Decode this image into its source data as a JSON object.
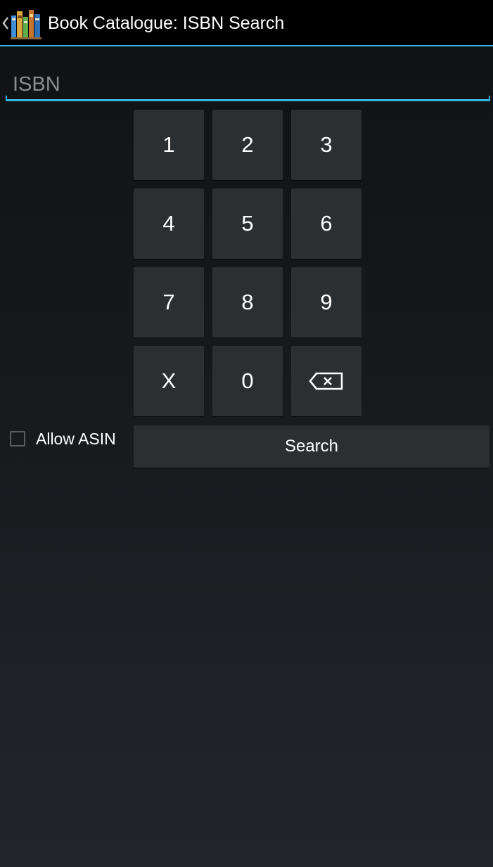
{
  "action_bar": {
    "title": "Book Catalogue: ISBN Search",
    "up_icon": "chevron-left-icon",
    "app_icon": "bookshelf-icon",
    "accent_color": "#33b5e5"
  },
  "isbn_field": {
    "value": "",
    "placeholder": "ISBN"
  },
  "keypad": {
    "keys": [
      {
        "label": "1"
      },
      {
        "label": "2"
      },
      {
        "label": "3"
      },
      {
        "label": "4"
      },
      {
        "label": "5"
      },
      {
        "label": "6"
      },
      {
        "label": "7"
      },
      {
        "label": "8"
      },
      {
        "label": "9"
      },
      {
        "label": "X"
      },
      {
        "label": "0"
      },
      {
        "icon": "backspace-icon"
      }
    ]
  },
  "allow_asin": {
    "label": "Allow ASIN",
    "checked": false
  },
  "search_button": {
    "label": "Search"
  }
}
